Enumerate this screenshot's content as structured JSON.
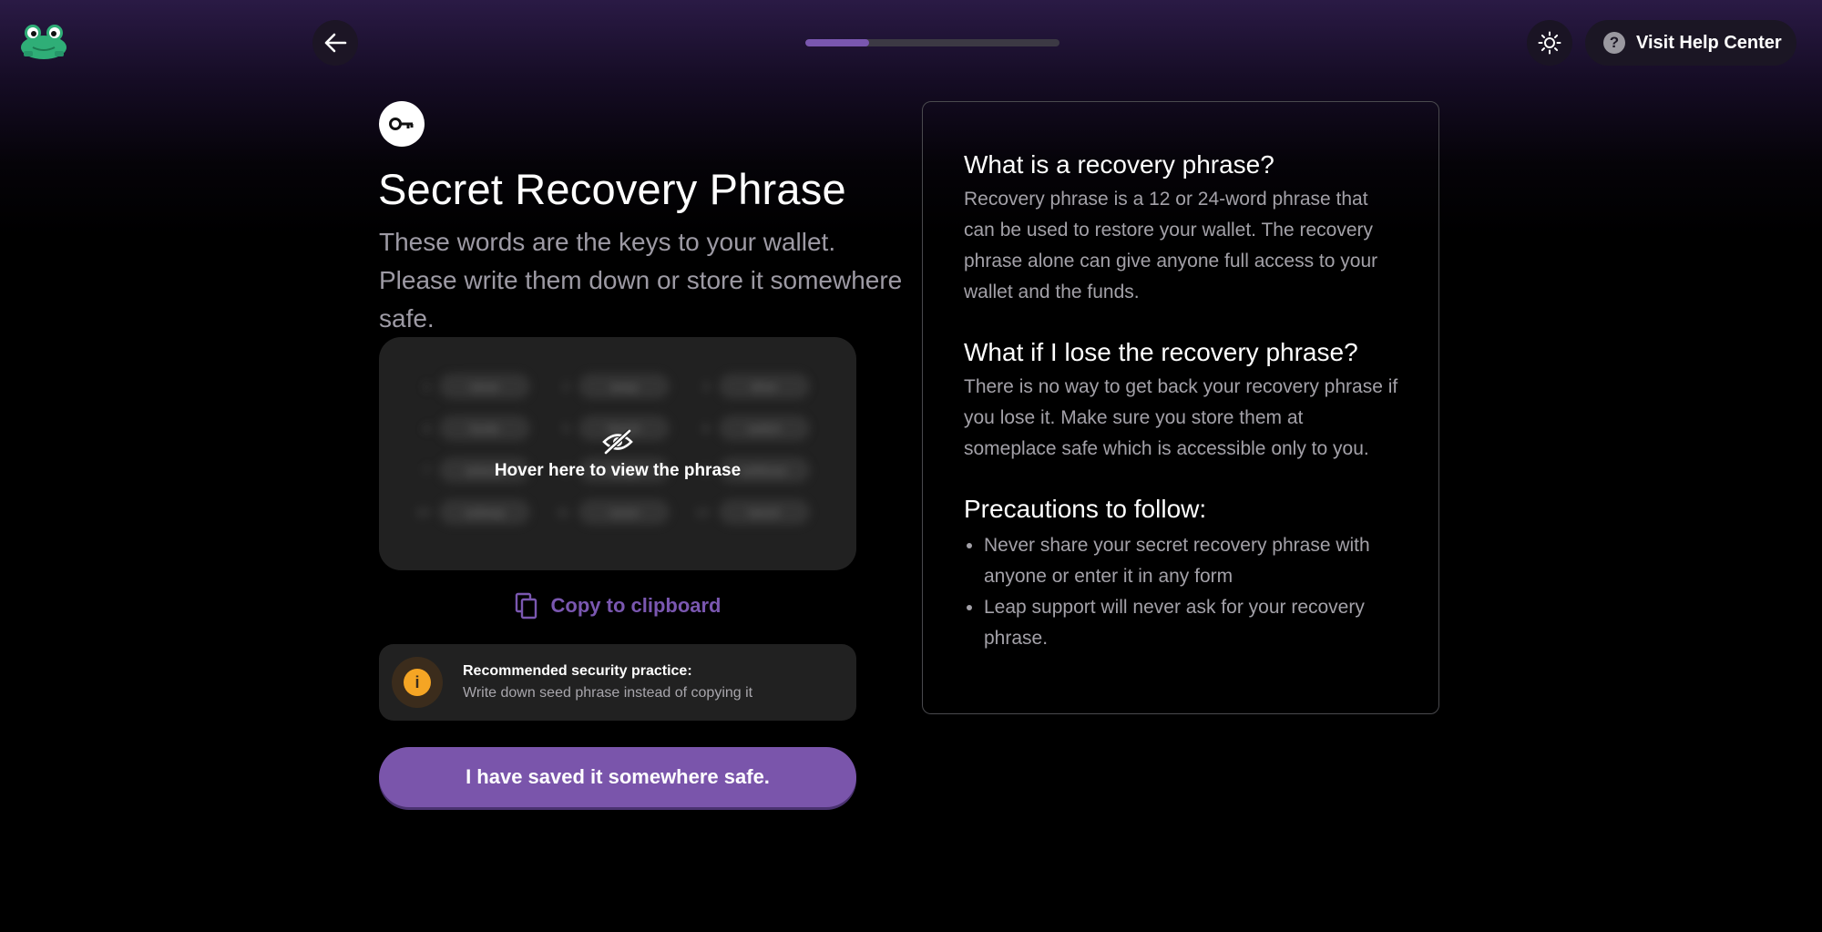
{
  "header": {
    "help_label": "Visit Help Center",
    "progress_fraction": 0.25
  },
  "main": {
    "title": "Secret Recovery Phrase",
    "subtitle": "These words are the keys to your wallet. Please write them down or store it somewhere safe.",
    "hover_text": "Hover here to view the phrase",
    "words": [
      {
        "num": "1",
        "word": "stone"
      },
      {
        "num": "2",
        "word": "away"
      },
      {
        "num": "3",
        "word": "drive"
      },
      {
        "num": "4",
        "word": "funds"
      },
      {
        "num": "5",
        "word": "beach"
      },
      {
        "num": "6",
        "word": "switch"
      },
      {
        "num": "7",
        "word": "artwork"
      },
      {
        "num": "8",
        "word": "image"
      },
      {
        "num": "9",
        "word": "wellness"
      },
      {
        "num": "10",
        "word": "subway"
      },
      {
        "num": "11",
        "word": "raven"
      },
      {
        "num": "12",
        "word": "barrel"
      }
    ],
    "copy_label": "Copy to clipboard",
    "note_title": "Recommended security practice:",
    "note_body": "Write down seed phrase instead of copying it",
    "confirm_label": "I have saved it somewhere safe."
  },
  "info": {
    "q1": "What is a recovery phrase?",
    "a1": "Recovery phrase is a 12 or 24-word phrase that can be used to restore your wallet. The recovery phrase alone can give anyone full access to your wallet and the funds.",
    "q2": "What if I lose the recovery phrase?",
    "a2": "There is no way to get back your recovery phrase if you lose it. Make sure you store them at someplace safe which is accessible only to you.",
    "q3": "Precautions to follow:",
    "bullets": [
      "Never share your secret recovery phrase with anyone or enter it in any form",
      "Leap support will never ask for your recovery phrase."
    ]
  },
  "colors": {
    "accent": "#7a57b0",
    "warning": "#f5a524",
    "panel": "#212121"
  },
  "icons": [
    "leap-frog-logo-icon",
    "arrow-left-icon",
    "sun-icon",
    "help-circle-icon",
    "key-icon",
    "eye-off-icon",
    "copy-icon",
    "info-icon"
  ]
}
